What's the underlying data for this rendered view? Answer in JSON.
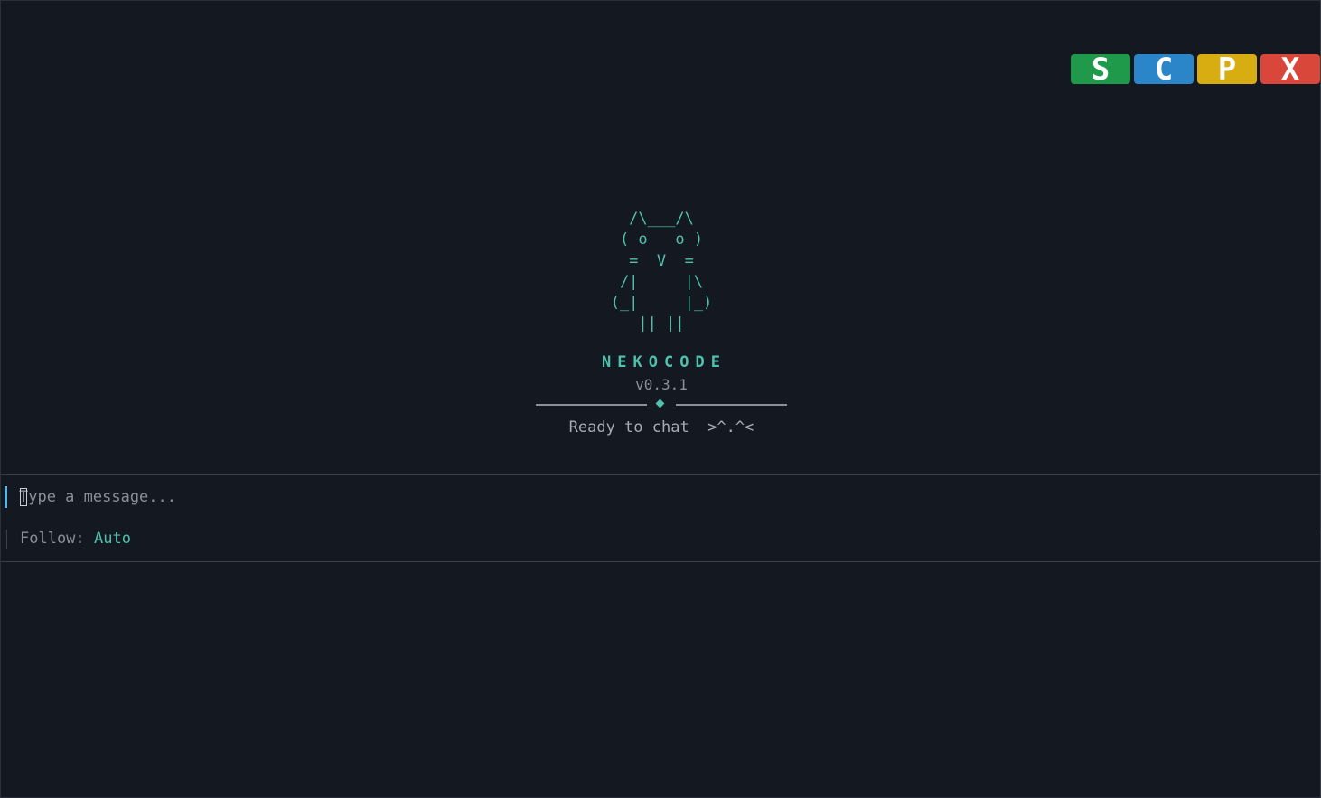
{
  "window_buttons": [
    {
      "label": "S",
      "color": "#1f9a4b",
      "icon": "save-icon"
    },
    {
      "label": "C",
      "color": "#2a86c9",
      "icon": "clear-icon"
    },
    {
      "label": "P",
      "color": "#d8ad12",
      "icon": "pin-icon"
    },
    {
      "label": "X",
      "color": "#d9473b",
      "icon": "close-icon"
    }
  ],
  "splash": {
    "ascii_lines": [
      "  /\\___/\\",
      " ( o   o )",
      "  =  V  =",
      " /|     |\\",
      "(_|     |_)",
      "   || ||"
    ],
    "brand": "NEKOCODE",
    "version": "v0.3.1",
    "status": "Ready to chat  >^.^<"
  },
  "composer": {
    "placeholder": "Type a message...",
    "value": ""
  },
  "follow": {
    "label": "Follow: ",
    "value": "Auto"
  },
  "colors": {
    "background": "#141821",
    "accent": "#4fc1ad",
    "muted": "#8a8f99",
    "input_bar": "#58b7e6"
  }
}
